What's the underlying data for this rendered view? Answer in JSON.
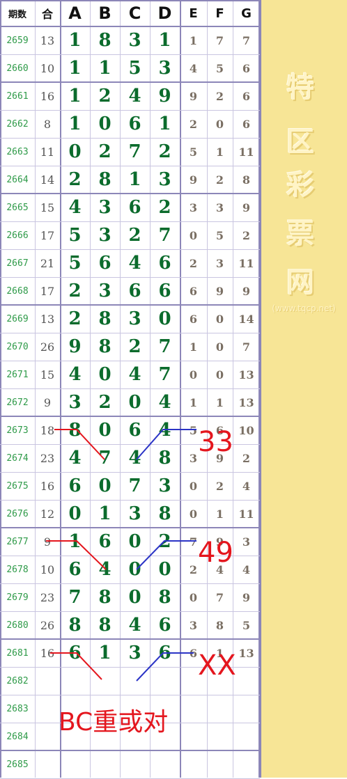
{
  "headers": [
    "期数",
    "合",
    "A",
    "B",
    "C",
    "D",
    "E",
    "F",
    "G"
  ],
  "rows": [
    {
      "period": "2659",
      "sum": "13",
      "main": [
        "1",
        "8",
        "3",
        "1"
      ],
      "minor": [
        "1",
        "7",
        "7"
      ]
    },
    {
      "period": "2660",
      "sum": "10",
      "main": [
        "1",
        "1",
        "5",
        "3"
      ],
      "minor": [
        "4",
        "5",
        "6"
      ]
    },
    {
      "period": "2661",
      "sum": "16",
      "main": [
        "1",
        "2",
        "4",
        "9"
      ],
      "minor": [
        "9",
        "2",
        "6"
      ]
    },
    {
      "period": "2662",
      "sum": "8",
      "main": [
        "1",
        "0",
        "6",
        "1"
      ],
      "minor": [
        "2",
        "0",
        "6"
      ]
    },
    {
      "period": "2663",
      "sum": "11",
      "main": [
        "0",
        "2",
        "7",
        "2"
      ],
      "minor": [
        "5",
        "1",
        "11"
      ]
    },
    {
      "period": "2664",
      "sum": "14",
      "main": [
        "2",
        "8",
        "1",
        "3"
      ],
      "minor": [
        "9",
        "2",
        "8"
      ]
    },
    {
      "period": "2665",
      "sum": "15",
      "main": [
        "4",
        "3",
        "6",
        "2"
      ],
      "minor": [
        "3",
        "3",
        "9"
      ]
    },
    {
      "period": "2666",
      "sum": "17",
      "main": [
        "5",
        "3",
        "2",
        "7"
      ],
      "minor": [
        "0",
        "5",
        "2"
      ]
    },
    {
      "period": "2667",
      "sum": "21",
      "main": [
        "5",
        "6",
        "4",
        "6"
      ],
      "minor": [
        "2",
        "3",
        "11"
      ]
    },
    {
      "period": "2668",
      "sum": "17",
      "main": [
        "2",
        "3",
        "6",
        "6"
      ],
      "minor": [
        "6",
        "9",
        "9"
      ]
    },
    {
      "period": "2669",
      "sum": "13",
      "main": [
        "2",
        "8",
        "3",
        "0"
      ],
      "minor": [
        "6",
        "0",
        "14"
      ]
    },
    {
      "period": "2670",
      "sum": "26",
      "main": [
        "9",
        "8",
        "2",
        "7"
      ],
      "minor": [
        "1",
        "0",
        "7"
      ]
    },
    {
      "period": "2671",
      "sum": "15",
      "main": [
        "4",
        "0",
        "4",
        "7"
      ],
      "minor": [
        "0",
        "0",
        "13"
      ]
    },
    {
      "period": "2672",
      "sum": "9",
      "main": [
        "3",
        "2",
        "0",
        "4"
      ],
      "minor": [
        "1",
        "1",
        "13"
      ]
    },
    {
      "period": "2673",
      "sum": "18",
      "main": [
        "8",
        "0",
        "6",
        "4"
      ],
      "minor": [
        "5",
        "6",
        "10"
      ]
    },
    {
      "period": "2674",
      "sum": "23",
      "main": [
        "4",
        "7",
        "4",
        "8"
      ],
      "minor": [
        "3",
        "9",
        "2"
      ]
    },
    {
      "period": "2675",
      "sum": "16",
      "main": [
        "6",
        "0",
        "7",
        "3"
      ],
      "minor": [
        "0",
        "2",
        "4"
      ]
    },
    {
      "period": "2676",
      "sum": "12",
      "main": [
        "0",
        "1",
        "3",
        "8"
      ],
      "minor": [
        "0",
        "1",
        "11"
      ]
    },
    {
      "period": "2677",
      "sum": "9",
      "main": [
        "1",
        "6",
        "0",
        "2"
      ],
      "minor": [
        "7",
        "9",
        "3"
      ]
    },
    {
      "period": "2678",
      "sum": "10",
      "main": [
        "6",
        "4",
        "0",
        "0"
      ],
      "minor": [
        "2",
        "4",
        "4"
      ]
    },
    {
      "period": "2679",
      "sum": "23",
      "main": [
        "7",
        "8",
        "0",
        "8"
      ],
      "minor": [
        "0",
        "7",
        "9"
      ]
    },
    {
      "period": "2680",
      "sum": "26",
      "main": [
        "8",
        "8",
        "4",
        "6"
      ],
      "minor": [
        "3",
        "8",
        "5"
      ]
    },
    {
      "period": "2681",
      "sum": "16",
      "main": [
        "6",
        "1",
        "3",
        "6"
      ],
      "minor": [
        "6",
        "1",
        "13"
      ]
    },
    {
      "period": "2682",
      "sum": "",
      "main": [
        "",
        "",
        "",
        ""
      ],
      "minor": [
        "",
        "",
        ""
      ]
    },
    {
      "period": "2683",
      "sum": "",
      "main": [
        "",
        "",
        "",
        ""
      ],
      "minor": [
        "",
        "",
        ""
      ]
    },
    {
      "period": "2684",
      "sum": "",
      "main": [
        "",
        "",
        "",
        ""
      ],
      "minor": [
        "",
        "",
        ""
      ]
    },
    {
      "period": "2685",
      "sum": "",
      "main": [
        "",
        "",
        "",
        ""
      ],
      "minor": [
        "",
        "",
        ""
      ]
    }
  ],
  "annotations": {
    "note_2673": "33",
    "note_2677": "49",
    "note_2681": "XX",
    "prediction": "BC重或对"
  },
  "watermark": {
    "chars": [
      "特",
      "区",
      "彩",
      "票",
      "网"
    ],
    "url": "(www.tqcp.net)"
  },
  "colors": {
    "period": "#2e9a48",
    "main_digits": "#0b6b2c",
    "minor_digits": "#7a6f63",
    "grid_line": "#8c86b8",
    "side_panel": "#f7e596",
    "annotation_red": "#e4161e",
    "annotation_blue": "#2b34c6"
  }
}
